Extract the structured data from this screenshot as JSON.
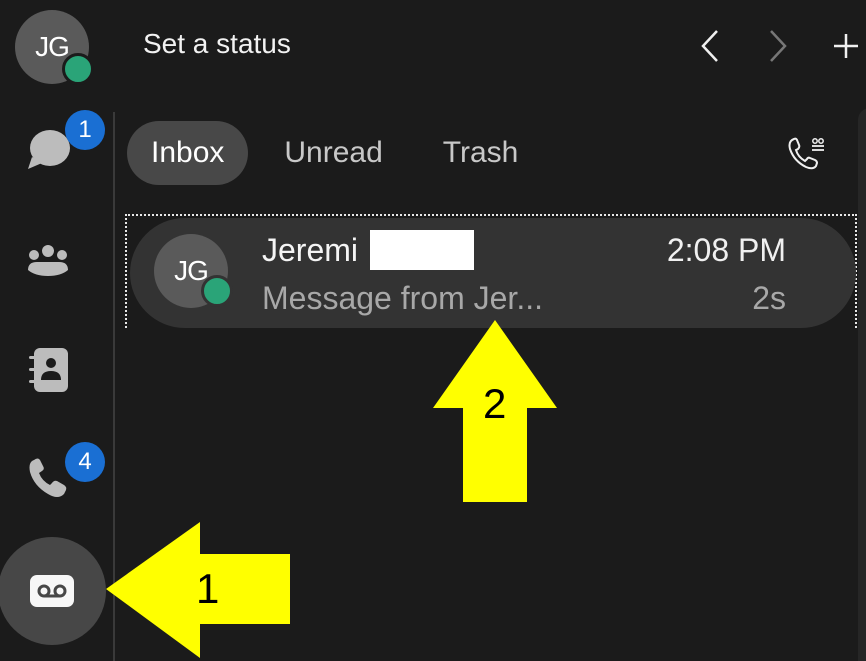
{
  "header": {
    "user_initials": "JG",
    "status_title": "Set a status",
    "back_icon": "chevron-left-icon",
    "forward_icon": "chevron-right-icon",
    "new_icon": "plus-icon"
  },
  "rail": {
    "items": [
      {
        "id": "messaging",
        "icon": "chat-bubble-icon",
        "badge": "1"
      },
      {
        "id": "teams",
        "icon": "people-group-icon",
        "badge": null
      },
      {
        "id": "contacts",
        "icon": "contact-book-icon",
        "badge": null
      },
      {
        "id": "calls",
        "icon": "phone-icon",
        "badge": "4"
      },
      {
        "id": "voicemail",
        "icon": "voicemail-icon",
        "badge": null,
        "active": true
      }
    ]
  },
  "tabs": [
    {
      "label": "Inbox",
      "active": true
    },
    {
      "label": "Unread",
      "active": false
    },
    {
      "label": "Trash",
      "active": false
    }
  ],
  "toolbar": {
    "call_voicemail_icon": "call-voicemail-icon"
  },
  "messages": [
    {
      "initials": "JG",
      "sender": "Jeremi",
      "time": "2:08 PM",
      "preview": "Message from Jer...",
      "duration": "2s"
    }
  ],
  "annotations": [
    {
      "number": "1",
      "color": "#ffff00"
    },
    {
      "number": "2",
      "color": "#ffff00"
    }
  ],
  "colors": {
    "background": "#1b1b1b",
    "presence_available": "#2aa478",
    "badge": "#1a6fd3",
    "annotation": "#ffff00"
  }
}
